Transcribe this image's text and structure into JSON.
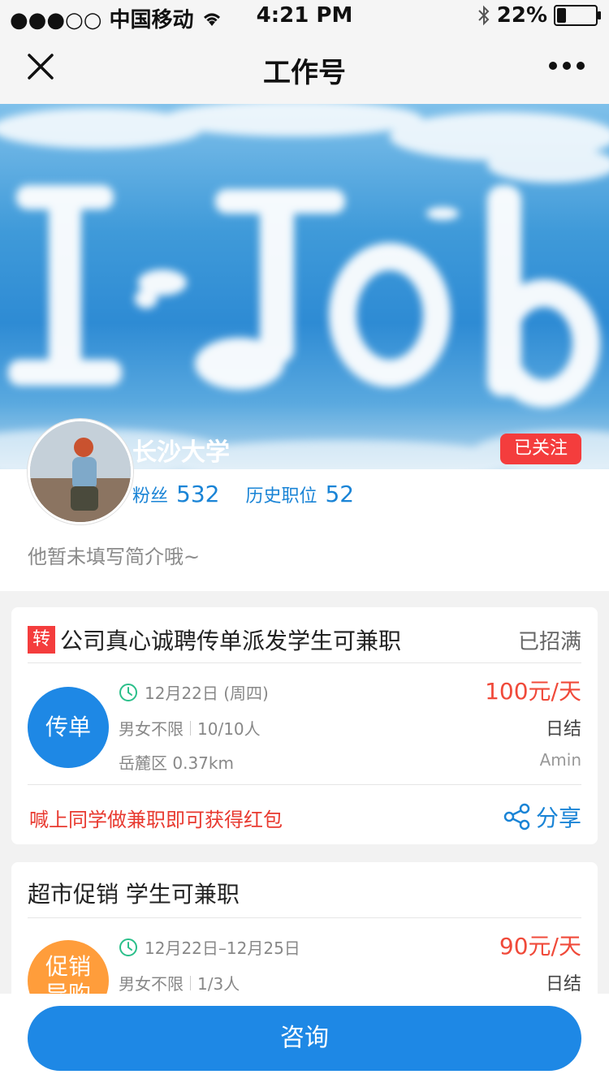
{
  "status_bar": {
    "carrier": "●●●○○ 中国移动",
    "time": "4:21 PM",
    "battery": "22%",
    "battery_level": 0.22
  },
  "nav": {
    "title": "工作号"
  },
  "profile": {
    "name": "长沙大学",
    "follow_label": "已关注",
    "fans_label": "粉丝",
    "fans_count": "532",
    "history_label": "历史职位",
    "history_count": "52",
    "bio": "他暂未填写简介哦~"
  },
  "jobs": [
    {
      "tag": "转",
      "title": "公司真心诚聘传单派发学生可兼职",
      "status": "已招满",
      "category": "传单",
      "date": "12月22日 (周四)",
      "gender": "男女不限",
      "count": "10/10人",
      "location": "岳麓区 0.37km",
      "price": "100元/天",
      "pay_type": "日结",
      "owner": "Amin",
      "promo": "喊上同学做兼职即可获得红包",
      "share_label": "分享"
    },
    {
      "title": "超市促销  学生可兼职",
      "category_line1": "促销",
      "category_line2": "导购",
      "date": "12月22日–12月25日",
      "gender": "男女不限",
      "count": "1/3人",
      "price": "90元/天",
      "pay_type": "日结"
    }
  ],
  "bottom": {
    "consult_label": "咨询"
  },
  "colors": {
    "primary_blue": "#1e88e5",
    "alert_red": "#f43d3d",
    "price_red": "#f04a3a",
    "orange": "#ff9d3b"
  },
  "icons": [
    "close-icon",
    "more-icon",
    "wifi-icon",
    "bluetooth-icon",
    "battery-icon",
    "clock-icon",
    "share-icon"
  ]
}
